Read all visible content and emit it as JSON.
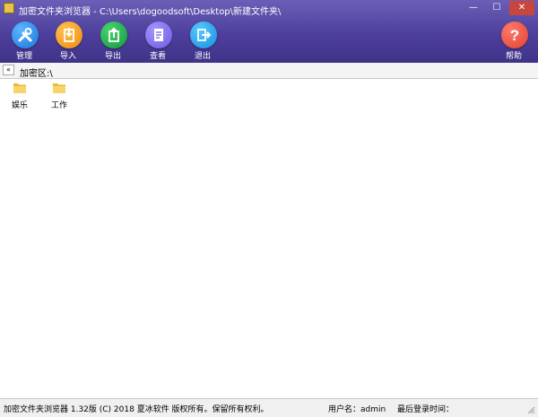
{
  "window": {
    "title": "加密文件夹浏览器 - C:\\Users\\dogoodsoft\\Desktop\\新建文件夹\\",
    "minimize": "—",
    "maximize": "☐",
    "close": "✕"
  },
  "toolbar": {
    "manage": "管理",
    "import": "导入",
    "export": "导出",
    "view": "查看",
    "exit": "退出",
    "help": "帮助"
  },
  "address": {
    "nav": "«",
    "path": "加密区:\\"
  },
  "files": [
    {
      "name": "娱乐",
      "icon": "folder-icon"
    },
    {
      "name": "工作",
      "icon": "folder-icon"
    }
  ],
  "status": {
    "version": "加密文件夹浏览器 1.32版 (C) 2018 夏冰软件 版权所有。保留所有权利。",
    "user": "用户名：admin",
    "last_login": "最后登录时间："
  },
  "colors": {
    "header_top": "#6a5fb6",
    "header_bottom": "#3f3388"
  }
}
